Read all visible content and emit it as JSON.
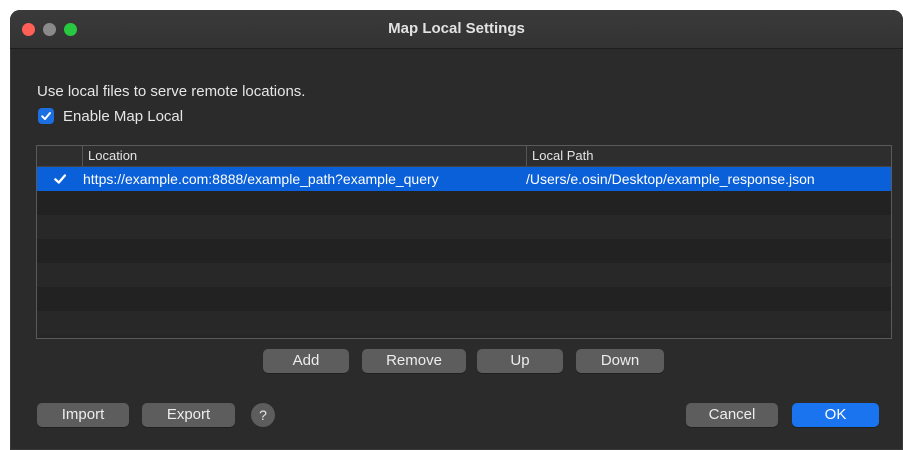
{
  "window": {
    "title": "Map Local Settings"
  },
  "description": "Use local files to serve remote locations.",
  "enable": {
    "label": "Enable Map Local",
    "checked": true
  },
  "table": {
    "columns": [
      "Location",
      "Local Path"
    ],
    "rows": [
      {
        "enabled": true,
        "location": "https://example.com:8888/example_path?example_query",
        "local_path": "/Users/e.osin/Desktop/example_response.json",
        "selected": true
      }
    ]
  },
  "row_buttons": {
    "add": "Add",
    "remove": "Remove",
    "up": "Up",
    "down": "Down"
  },
  "footer": {
    "import": "Import",
    "export": "Export",
    "help": "?",
    "cancel": "Cancel",
    "ok": "OK"
  },
  "colors": {
    "window_bg": "#2b2b2b",
    "selection": "#0a60d8",
    "accent": "#1a74f0",
    "close": "#fe5f57",
    "maximize": "#28c840"
  }
}
